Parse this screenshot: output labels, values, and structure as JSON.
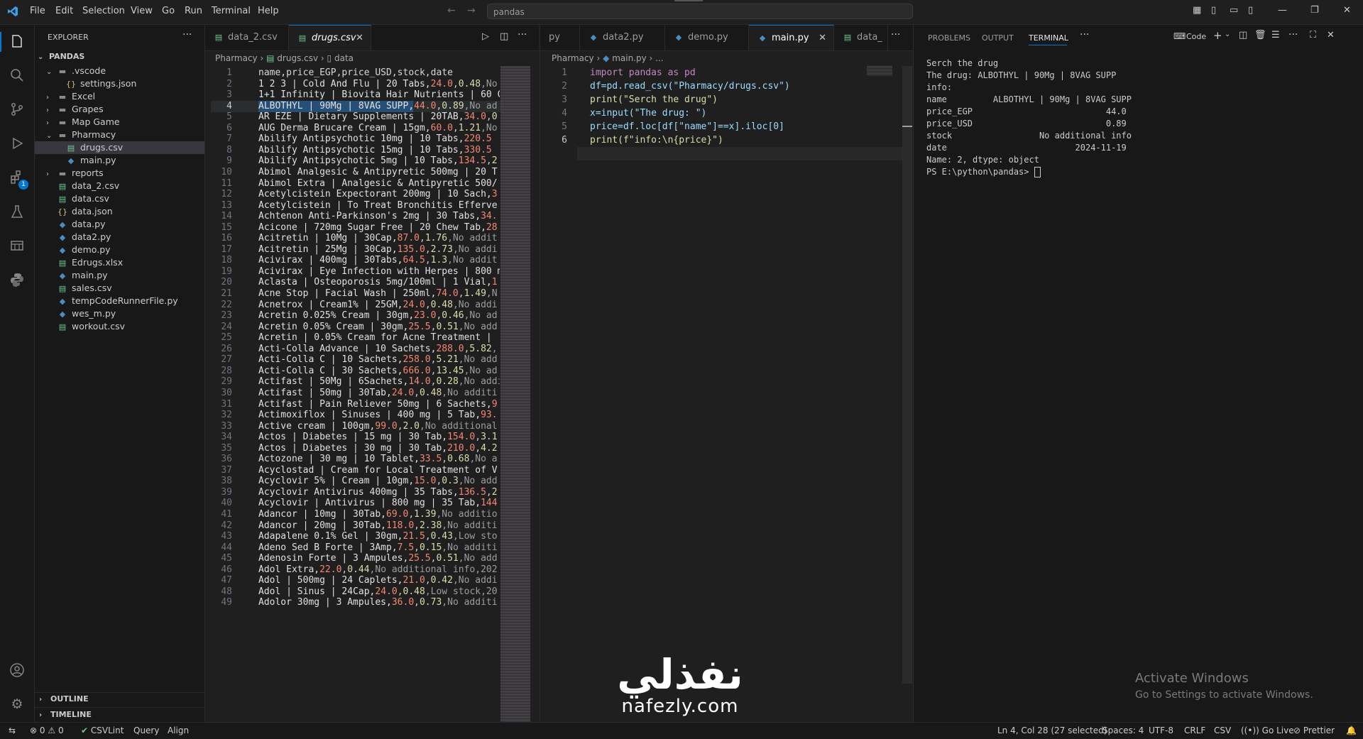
{
  "menu": [
    "File",
    "Edit",
    "Selection",
    "View",
    "Go",
    "Run",
    "Terminal",
    "Help"
  ],
  "search_text": "pandas",
  "explorer": {
    "title": "EXPLORER",
    "root": "PANDAS",
    "items": [
      {
        "label": ".vscode",
        "type": "folder-open",
        "depth": 1
      },
      {
        "label": "settings.json",
        "type": "json",
        "depth": 2
      },
      {
        "label": "Excel",
        "type": "folder",
        "depth": 1
      },
      {
        "label": "Grapes",
        "type": "folder",
        "depth": 1
      },
      {
        "label": "Map Game",
        "type": "folder",
        "depth": 1
      },
      {
        "label": "Pharmacy",
        "type": "folder-open",
        "depth": 1
      },
      {
        "label": "drugs.csv",
        "type": "csv",
        "depth": 2,
        "selected": true
      },
      {
        "label": "main.py",
        "type": "py",
        "depth": 2
      },
      {
        "label": "reports",
        "type": "folder",
        "depth": 1
      },
      {
        "label": "data_2.csv",
        "type": "csv",
        "depth": 1
      },
      {
        "label": "data.csv",
        "type": "csv",
        "depth": 1
      },
      {
        "label": "data.json",
        "type": "json",
        "depth": 1
      },
      {
        "label": "data.py",
        "type": "py",
        "depth": 1
      },
      {
        "label": "data2.py",
        "type": "py",
        "depth": 1
      },
      {
        "label": "demo.py",
        "type": "py",
        "depth": 1
      },
      {
        "label": "Edrugs.xlsx",
        "type": "xlsx",
        "depth": 1
      },
      {
        "label": "main.py",
        "type": "py",
        "depth": 1
      },
      {
        "label": "sales.csv",
        "type": "csv",
        "depth": 1
      },
      {
        "label": "tempCodeRunnerFile.py",
        "type": "py",
        "depth": 1
      },
      {
        "label": "wes_m.py",
        "type": "py",
        "depth": 1
      },
      {
        "label": "workout.csv",
        "type": "csv",
        "depth": 1
      }
    ],
    "outline": "OUTLINE",
    "timeline": "TIMELINE"
  },
  "editor1": {
    "tabs": [
      "data_2.csv",
      "drugs.csv"
    ],
    "crumbs": [
      "Pharmacy",
      "drugs.csv",
      "data"
    ],
    "lines": [
      [
        "name,price_EGP,price_USD,stock,date",
        "",
        "",
        ""
      ],
      [
        "1 2 3 | Cold And Flu | 20 Tabs,",
        "24.0",
        "0.48",
        ",No"
      ],
      [
        "1+1 Infinity | Biovita Hair Nutrients | 60 C",
        "",
        "",
        ""
      ],
      [
        "ALBOTHYL | 90Mg | 8VAG SUPP,",
        "44.0",
        "0.89",
        ",No ad"
      ],
      [
        "AR EZE | Dietary Supplements | 20TAB,",
        "34.0",
        "0",
        ""
      ],
      [
        "AUG Derma Brucare Cream | 15gm,",
        "60.0",
        "1.21",
        ",No"
      ],
      [
        "Abilify Antipsychotic 10mg | 10 Tabs,",
        "220.5",
        "",
        ""
      ],
      [
        "Abilify Antipsychotic 15mg | 10 Tabs,",
        "330.5",
        "",
        ""
      ],
      [
        "Abilify Antipsychotic 5mg | 10 Tabs,",
        "134.5",
        "2",
        ""
      ],
      [
        "Abimol Analgesic & Antipyretic 500mg | 20 T",
        "",
        "",
        ""
      ],
      [
        "Abimol Extra | Analgesic & Antipyretic 500/",
        "",
        "",
        ""
      ],
      [
        "Acetylcistein Expectorant 200mg | 10 Sach,",
        "3",
        "",
        ""
      ],
      [
        "Acetylcistein | To Treat Bronchitis Efferve",
        "",
        "",
        ""
      ],
      [
        "Achtenon Anti-Parkinson's 2mg | 30 Tabs,",
        "34.",
        "",
        ""
      ],
      [
        "Acicone | 720mg Sugar Free | 20 Chew Tab,",
        "28",
        "",
        ""
      ],
      [
        "Acitretin | 10Mg | 30Cap,",
        "87.0",
        "1.76",
        ",No addit"
      ],
      [
        "Acitretin | 25Mg | 30Cap,",
        "135.0",
        "2.73",
        ",No addi"
      ],
      [
        "Acivirax | 400mg | 30Tabs,",
        "64.5",
        "1.3",
        ",No addit"
      ],
      [
        "Acivirax | Eye Infection with Herpes | 800 m",
        "",
        "",
        ""
      ],
      [
        "Aclasta | Osteoporosis 5mg/100ml | 1 Vial,",
        "1",
        "",
        ""
      ],
      [
        "Acne Stop | Facial Wash | 250ml,",
        "74.0",
        "1.49",
        ",N"
      ],
      [
        "Acnetrox | Cream1% | 25GM,",
        "24.0",
        "0.48",
        ",No addi"
      ],
      [
        "Acretin 0.025% Cream | 30gm,",
        "23.0",
        "0.46",
        ",No ad"
      ],
      [
        "Acretin 0.05% Cream | 30gm,",
        "25.5",
        "0.51",
        ",No add"
      ],
      [
        "Acretin | 0.05% Cream for Acne Treatment | ",
        "",
        "",
        ""
      ],
      [
        "Acti-Colla Advance | 10 Sachets,",
        "288.0",
        "5.82",
        ","
      ],
      [
        "Acti-Colla C | 10 Sachets,",
        "258.0",
        "5.21",
        ",No add"
      ],
      [
        "Acti-Colla C | 30 Sachets,",
        "666.0",
        "13.45",
        ",No ad"
      ],
      [
        "Actifast | 50Mg | 6Sachets,",
        "14.0",
        "0.28",
        ",No addi"
      ],
      [
        "Actifast | 50mg | 30Tab,",
        "24.0",
        "0.48",
        ",No additi"
      ],
      [
        "Actifast | Pain Reliever 50mg | 6 Sachets,",
        "9",
        "",
        ""
      ],
      [
        "Actimoxiflox | Sinuses | 400 mg | 5 Tab,",
        "93.",
        "",
        ""
      ],
      [
        "Active cream | 100gm,",
        "99.0",
        "2.0",
        ",No additional"
      ],
      [
        "Actos | Diabetes | 15 mg | 30 Tab,",
        "154.0",
        "3.1",
        ""
      ],
      [
        "Actos | Diabetes | 30 mg | 30 Tab,",
        "210.0",
        "4.2",
        ""
      ],
      [
        "Actozone | 30 mg | 10 Tablet,",
        "33.5",
        "0.68",
        ",No a"
      ],
      [
        "Acyclostad | Cream for Local Treatment of V",
        "",
        "",
        ""
      ],
      [
        "Acyclovir 5% | Cream | 10gm,",
        "15.0",
        "0.3",
        ",No add"
      ],
      [
        "Acyclovir Antivirus 400mg | 35 Tabs,",
        "136.5",
        "2",
        ""
      ],
      [
        "Acyclovir | Antivirus | 800 mg | 35 Tab,",
        "144",
        "",
        ""
      ],
      [
        "Adancor | 10mg | 30Tab,",
        "69.0",
        "1.39",
        ",No additio"
      ],
      [
        "Adancor | 20mg | 30Tab,",
        "118.0",
        "2.38",
        ",No additi"
      ],
      [
        "Adapalene 0.1% Gel | 30gm,",
        "21.5",
        "0.43",
        ",Low sto"
      ],
      [
        "Adeno Sed B Forte | 3Amp,",
        "7.5",
        "0.15",
        ",No additi"
      ],
      [
        "Adenosin Forte | 3 Ampules,",
        "25.5",
        "0.51",
        ",No add"
      ],
      [
        "Adol Extra,",
        "22.0",
        "0.44",
        ",No additional info,202"
      ],
      [
        "Adol | 500mg | 24 Caplets,",
        "21.0",
        "0.42",
        ",No addi"
      ],
      [
        "Adol | Sinus | 24Cap,",
        "24.0",
        "0.48",
        ",Low stock,20"
      ],
      [
        "Adolor 30mg | 3 Ampules,",
        "36.0",
        "0.73",
        ",No additi"
      ]
    ]
  },
  "editor2": {
    "tabs": [
      "py",
      "data2.py",
      "demo.py",
      "main.py",
      "data_"
    ],
    "crumbs": [
      "Pharmacy",
      "main.py",
      "..."
    ],
    "lines": [
      "import pandas as pd",
      "df=pd.read_csv(\"Pharmacy/drugs.csv\")",
      "print(\"Serch the drug\")",
      "x=input(\"The drug: \")",
      "price=df.loc[df[\"name\"]==x].iloc[0]",
      "print(f\"info:\\n{price}\")"
    ]
  },
  "panel": {
    "tabs": [
      "PROBLEMS",
      "OUTPUT",
      "TERMINAL"
    ],
    "active_tab": "TERMINAL",
    "shell_label": "Code",
    "terminal_lines": [
      "Serch the drug",
      "The drug: ALBOTHYL | 90Mg | 8VAG SUPP",
      "info:",
      "name         ALBOTHYL | 90Mg | 8VAG SUPP",
      "price_EGP                          44.0",
      "price_USD                          0.89",
      "stock                 No additional info",
      "date                         2024-11-19",
      "Name: 2, dtype: object",
      "PS E:\\python\\pandas> "
    ],
    "watermark_title": "Activate Windows",
    "watermark_sub": "Go to Settings to activate Windows."
  },
  "logo": {
    "arabic": "نفذلي",
    "latin": "nafezly.com"
  },
  "status": {
    "errors": "0",
    "warnings": "0",
    "csvlint": "CSVLint",
    "query": "Query",
    "align": "Align",
    "position": "Ln 4, Col 28 (27 selected)",
    "spaces": "Spaces: 4",
    "encoding": "UTF-8",
    "eol": "CRLF",
    "language": "CSV",
    "golive": "Go Live",
    "prettier": "Prettier"
  }
}
